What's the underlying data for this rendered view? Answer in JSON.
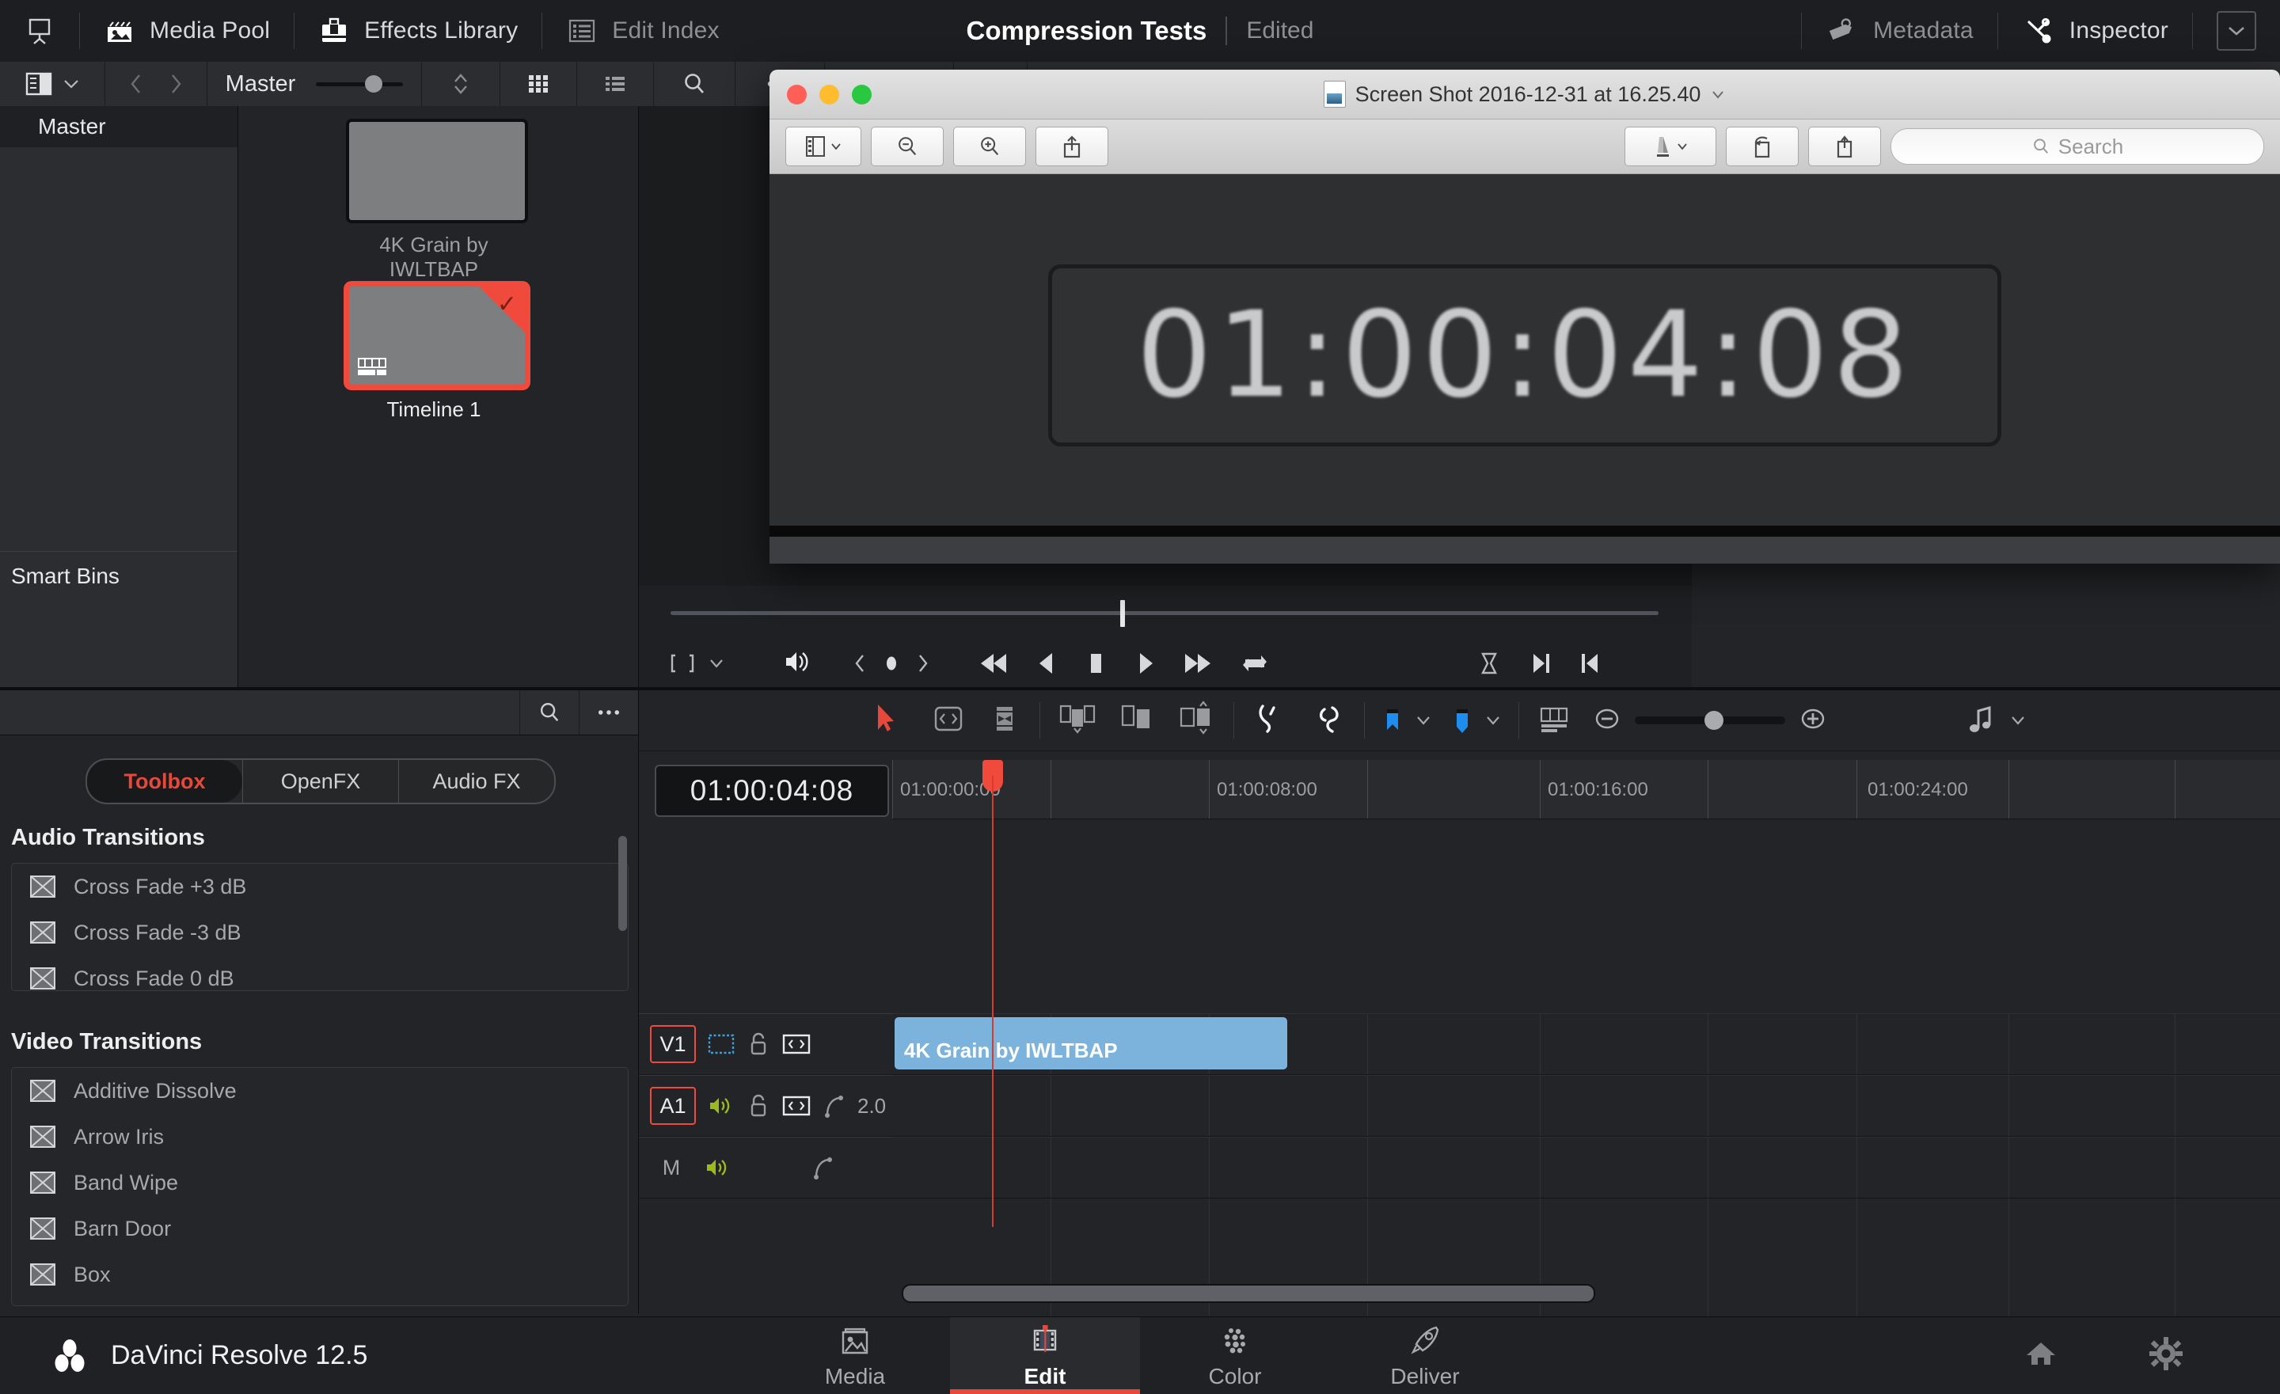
{
  "app": {
    "name": "DaVinci Resolve 12.5",
    "project_title": "Compression Tests",
    "project_status": "Edited"
  },
  "topbar": {
    "items": [
      {
        "label": "Media Pool",
        "icon": "media-pool-icon"
      },
      {
        "label": "Effects Library",
        "icon": "effects-library-icon"
      },
      {
        "label": "Edit Index",
        "icon": "edit-index-icon"
      }
    ],
    "right_items": [
      {
        "label": "Metadata",
        "icon": "metadata-icon"
      },
      {
        "label": "Inspector",
        "icon": "inspector-icon"
      }
    ],
    "workspace_icon": "workspace-toggle-icon",
    "chevron_icon": "chevron-down-icon"
  },
  "media_toolbar": {
    "view_icon": "panel-layout-icon",
    "chevron_icon": "chevron-down-icon",
    "back_icon": "chevron-left-icon",
    "forward_icon": "chevron-right-icon",
    "bin_label": "Master",
    "sort_icon": "sort-updown-icon",
    "grid_icon": "grid-view-icon",
    "list_icon": "list-view-icon",
    "search_icon": "search-icon",
    "more_icon": "more-options-icon",
    "zoom_level": "57%",
    "partial_value": "0"
  },
  "bin_tree": {
    "header": "Master",
    "smart_bins": "Smart Bins"
  },
  "media_pool": {
    "items": [
      {
        "name": "4K Grain by IWLTBAP",
        "selected": false,
        "type": "clip"
      },
      {
        "name": "Timeline 1",
        "selected": true,
        "type": "timeline"
      }
    ]
  },
  "effects_library": {
    "search_icon": "search-icon",
    "more_icon": "more-options-icon",
    "tabs": [
      {
        "label": "Toolbox",
        "active": true
      },
      {
        "label": "OpenFX",
        "active": false
      },
      {
        "label": "Audio FX",
        "active": false
      }
    ],
    "groups": [
      {
        "title": "Audio Transitions",
        "items": [
          "Cross Fade +3 dB",
          "Cross Fade -3 dB",
          "Cross Fade 0 dB"
        ]
      },
      {
        "title": "Video Transitions",
        "items": [
          "Additive Dissolve",
          "Arrow Iris",
          "Band Wipe",
          "Barn Door",
          "Box"
        ]
      }
    ]
  },
  "transport": {
    "buttons": [
      {
        "name": "frame-fit-icon",
        "glyph": "⬜"
      },
      {
        "name": "chevron-down-icon",
        "glyph": "∨"
      },
      {
        "name": "audio-volume-icon",
        "glyph": "🔊"
      },
      {
        "name": "prev-keyframe-icon",
        "glyph": "‹"
      },
      {
        "name": "keyframe-icon",
        "glyph": "●"
      },
      {
        "name": "next-keyframe-icon",
        "glyph": "›"
      },
      {
        "name": "jump-start-icon",
        "glyph": "⏮"
      },
      {
        "name": "play-reverse-icon",
        "glyph": "◀"
      },
      {
        "name": "stop-icon",
        "glyph": "■"
      },
      {
        "name": "play-icon",
        "glyph": "▶"
      },
      {
        "name": "jump-end-icon",
        "glyph": "⏭"
      },
      {
        "name": "loop-icon",
        "glyph": "⟳"
      },
      {
        "name": "mark-inout-icon",
        "glyph": "⬚"
      },
      {
        "name": "mark-out-icon",
        "glyph": "▶|"
      },
      {
        "name": "mark-in-icon",
        "glyph": "|◀"
      }
    ]
  },
  "timeline_toolbar": {
    "tools": [
      {
        "name": "selection-tool-icon",
        "active": true
      },
      {
        "name": "trim-edit-tool-icon",
        "active": false
      },
      {
        "name": "dynamic-trim-tool-icon",
        "active": false
      },
      {
        "name": "razor-tool-icon",
        "active": false
      },
      {
        "name": "insert-clip-icon",
        "active": false
      },
      {
        "name": "overwrite-clip-icon",
        "active": false
      },
      {
        "name": "replace-clip-icon",
        "active": false
      },
      {
        "name": "snapping-icon",
        "active": false
      },
      {
        "name": "linked-selection-icon",
        "active": false
      },
      {
        "name": "flag-icon",
        "active": false
      },
      {
        "name": "marker-icon",
        "active": false
      },
      {
        "name": "track-height-icon",
        "active": false
      },
      {
        "name": "zoom-out-icon",
        "active": false
      },
      {
        "name": "zoom-slider",
        "active": false
      },
      {
        "name": "zoom-in-icon",
        "active": false
      },
      {
        "name": "audio-waveform-icon",
        "active": false
      }
    ]
  },
  "timeline": {
    "current_timecode": "01:00:04:08",
    "ruler_labels": [
      "01:00:00:00",
      "01:00:08:00",
      "01:00:16:00",
      "01:00:24:00"
    ],
    "tracks": [
      {
        "name": "V1",
        "kind": "video",
        "icons": [
          "video-monitor-icon",
          "lock-icon",
          "auto-select-icon"
        ],
        "value": "",
        "clips": [
          {
            "label": "4K Grain by IWLTBAP"
          }
        ]
      },
      {
        "name": "A1",
        "kind": "audio",
        "icons": [
          "audio-mute-icon",
          "lock-icon",
          "auto-select-icon",
          "audio-curve-icon"
        ],
        "value": "2.0",
        "clips": []
      },
      {
        "name": "M",
        "kind": "master",
        "icons": [
          "audio-mute-icon",
          "audio-curve-icon"
        ],
        "value": "",
        "clips": []
      }
    ]
  },
  "preview_window": {
    "title": "Screen Shot 2016-12-31 at 16.25.40",
    "title_chevron": "chevron-down-icon",
    "traffic_lights": [
      {
        "name": "close-button",
        "color": "#ff5f57"
      },
      {
        "name": "minimize-button",
        "color": "#febc2e"
      },
      {
        "name": "zoom-button",
        "color": "#28c840"
      }
    ],
    "toolbar_buttons": [
      {
        "name": "sidebar-view-icon"
      },
      {
        "name": "zoom-out-icon"
      },
      {
        "name": "zoom-in-icon"
      },
      {
        "name": "share-icon"
      },
      {
        "name": "markup-icon"
      },
      {
        "name": "rotate-icon"
      },
      {
        "name": "annotate-icon"
      }
    ],
    "search_placeholder": "Search",
    "content_timecode": "01:00:04:08"
  },
  "bottom_nav": {
    "pages": [
      {
        "label": "Media",
        "icon": "media-page-icon",
        "active": false
      },
      {
        "label": "Edit",
        "icon": "edit-page-icon",
        "active": true
      },
      {
        "label": "Color",
        "icon": "color-page-icon",
        "active": false
      },
      {
        "label": "Deliver",
        "icon": "deliver-page-icon",
        "active": false
      }
    ],
    "right_icons": [
      {
        "name": "home-icon"
      },
      {
        "name": "settings-gear-icon"
      }
    ]
  },
  "colors": {
    "accent_red": "#e8483a",
    "clip_blue": "#7cb3dc",
    "panel_bg": "#232427",
    "toolbar_bg": "#2c2d31"
  }
}
